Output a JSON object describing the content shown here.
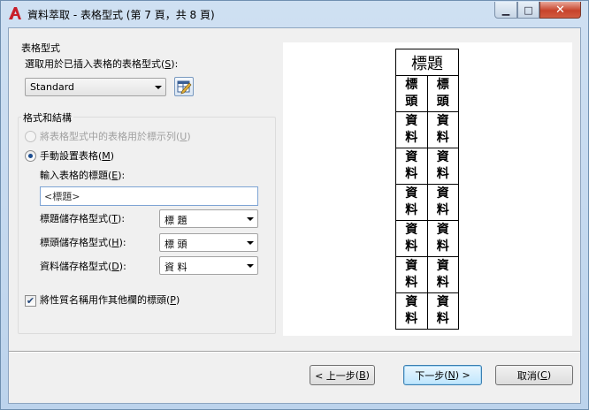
{
  "window": {
    "title": "資料萃取 - 表格型式 (第 7 頁，共 8 頁)",
    "minimize_glyph": "▁",
    "maximize_glyph": "□",
    "close_glyph": "✕"
  },
  "table_style": {
    "group_label": "表格型式",
    "select_label": "選取用於已插入表格的表格型式",
    "select_hotkey": "S",
    "selected_value": "Standard",
    "edit_icon": "table-style-edit-icon"
  },
  "format": {
    "group_label": "格式和結構",
    "option_label_row": {
      "label": "將表格型式中的表格用於標示列",
      "hotkey": "U",
      "enabled": false,
      "selected": false
    },
    "option_manual": {
      "label": "手動設置表格",
      "hotkey": "M",
      "selected": true
    },
    "title_prompt": "輸入表格的標題",
    "title_prompt_hotkey": "E",
    "title_value": "<標題>",
    "title_cell_style_label": "標題儲存格型式",
    "title_cell_style_hotkey": "T",
    "title_cell_style_value": "標 題",
    "header_cell_style_label": "標頭儲存格型式",
    "header_cell_style_hotkey": "H",
    "header_cell_style_value": "標 頭",
    "data_cell_style_label": "資料儲存格型式",
    "data_cell_style_hotkey": "D",
    "data_cell_style_value": "資 料",
    "property_name_checkbox_label": "將性質名稱用作其他欄的標頭",
    "property_name_checkbox_hotkey": "P",
    "property_name_checked": true
  },
  "preview": {
    "title": "標題",
    "header_cells": [
      "標\n頭",
      "標\n頭"
    ],
    "data_rows": [
      [
        "資\n料",
        "資\n料"
      ],
      [
        "資\n料",
        "資\n料"
      ],
      [
        "資\n料",
        "資\n料"
      ],
      [
        "資\n料",
        "資\n料"
      ],
      [
        "資\n料",
        "資\n料"
      ],
      [
        "資\n料",
        "資\n料"
      ]
    ]
  },
  "buttons": {
    "back_label": "< 上一步",
    "back_hotkey": "B",
    "next_label": "下一步",
    "next_hotkey": "N",
    "next_suffix": " >",
    "cancel_label": "取消",
    "cancel_hotkey": "C"
  },
  "colors": {
    "app_icon_red": "#c8202b",
    "title_bar": "#c9dcef",
    "close_button": "#c7432b"
  }
}
